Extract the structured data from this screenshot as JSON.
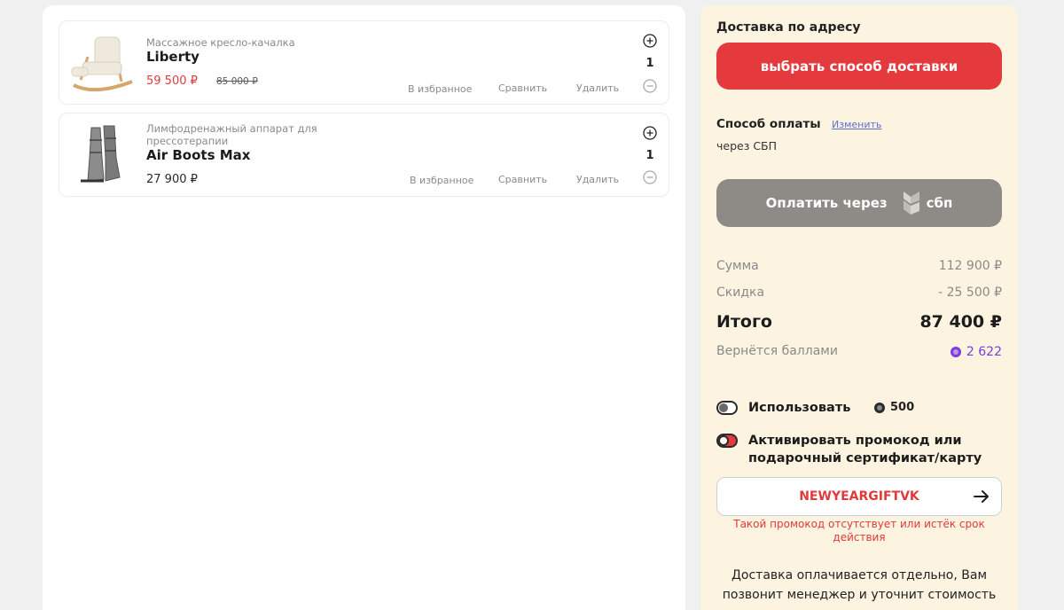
{
  "cart": {
    "items": [
      {
        "subtitle": "Массажное кресло-качалка",
        "name": "Liberty",
        "price": "59 500 ₽",
        "old_price": "85 000 ₽",
        "qty": "1",
        "favorite": "В избранное",
        "compare": "Сравнить",
        "remove": "Удалить"
      },
      {
        "subtitle": "Лимфодренажный аппарат для прессотерапии",
        "name": "Air Boots Max",
        "price": "27 900 ₽",
        "qty": "1",
        "favorite": "В избранное",
        "compare": "Сравнить",
        "remove": "Удалить"
      }
    ]
  },
  "summary": {
    "delivery_title": "Доставка по адресу",
    "delivery_button": "выбрать способ доставки",
    "payment_title": "Способ оплаты",
    "payment_change": "Изменить",
    "payment_method": "через СБП",
    "pay_button": "Оплатить через",
    "pay_button_logo_text": "сбп",
    "sum_label": "Сумма",
    "sum_value": "112 900 ₽",
    "discount_label": "Скидка",
    "discount_value": "- 25 500 ₽",
    "total_label": "Итого",
    "total_value": "87 400 ₽",
    "bonus_label": "Вернётся баллами",
    "bonus_value": "2 622",
    "use_points_label": "Использовать",
    "use_points_value": "500",
    "promo_toggle_label": "Активировать промокод или подарочный сертификат/карту",
    "promo_code": "NEWYEARGIFTVK",
    "promo_error": "Такой промокод отсутствует или истёк срок действия",
    "delivery_note": "Доставка оплачивается отдельно, Вам позвонит менеджер и уточнит стоимость"
  },
  "colors": {
    "accent_red": "#e53a3d",
    "summary_bg": "#fdf3e1",
    "pay_button_bg": "#8e8a85",
    "bonus_purple": "#7a3de0"
  }
}
